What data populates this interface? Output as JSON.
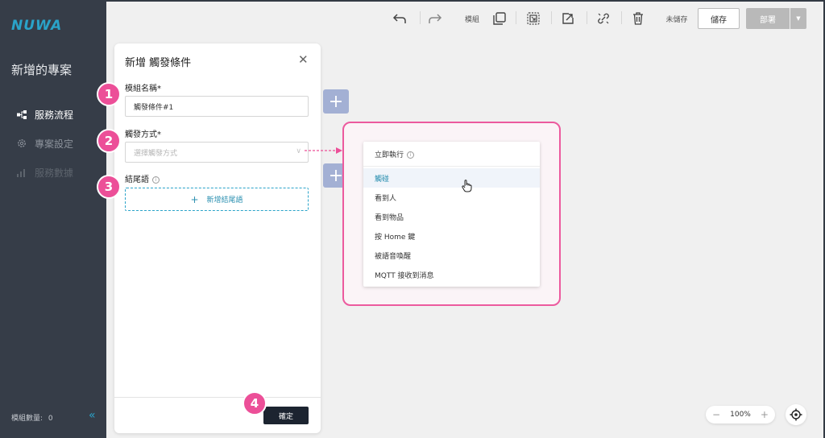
{
  "app": {
    "logo": "NUWA",
    "project_name": "新增的專案"
  },
  "sidebar": {
    "items": [
      {
        "label": "服務流程",
        "icon": "flow-icon",
        "active": true
      },
      {
        "label": "專案設定",
        "icon": "gear-icon",
        "active": false
      },
      {
        "label": "服務數據",
        "icon": "chart-icon",
        "active": false
      }
    ],
    "module_count_label": "模組數量:",
    "module_count": "0"
  },
  "toolbar": {
    "module_label": "模組",
    "unsaved_label": "未儲存",
    "save_label": "儲存",
    "deploy_label": "部署"
  },
  "panel": {
    "title": "新增 觸發條件",
    "module_name_label": "模組名稱*",
    "module_name_value": "觸發條件#1",
    "trigger_label": "觸發方式*",
    "trigger_placeholder": "選擇觸發方式",
    "ending_label": "結尾語",
    "add_ending_label": "新增結尾語",
    "confirm_label": "確定"
  },
  "callouts": [
    "1",
    "2",
    "3",
    "4"
  ],
  "dropdown": {
    "header": "立即執行",
    "items": [
      "觸碰",
      "看到人",
      "看到物品",
      "按 Home 鍵",
      "被語音喚醒",
      "MQTT 接收到消息"
    ],
    "hovered_index": 0
  },
  "zoom": {
    "level": "100%"
  },
  "colors": {
    "accent": "#2aa3c9",
    "callout": "#ec4f98",
    "sidebar": "#363d48",
    "confirm": "#1c2430"
  }
}
